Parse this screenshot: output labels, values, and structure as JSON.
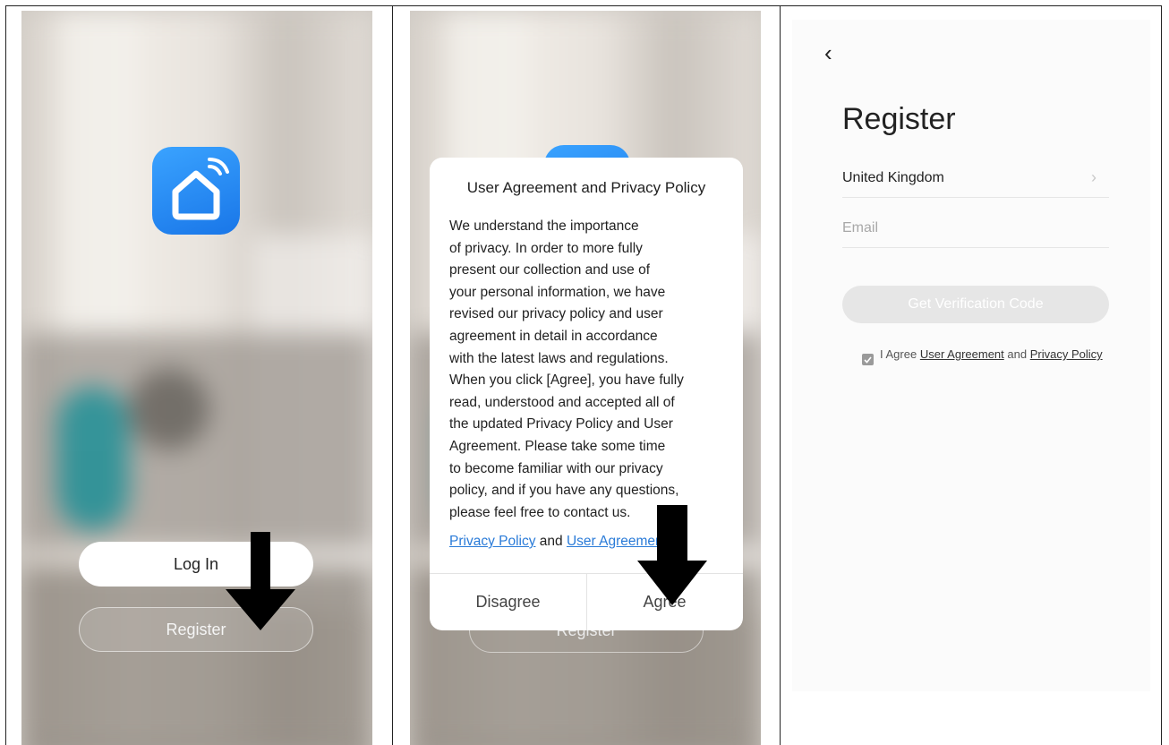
{
  "panel1": {
    "login_label": "Log In",
    "register_label": "Register"
  },
  "panel2": {
    "behind_register_label": "Register",
    "dialog": {
      "title": "User Agreement and Privacy Policy",
      "body": "We understand the importance\nof privacy. In order to more fully\npresent our collection and use of\nyour personal information, we have\nrevised our privacy policy and user\nagreement in detail in accordance\nwith the latest laws and regulations.\nWhen you click [Agree], you have fully\nread, understood and accepted all of\nthe updated Privacy Policy and User\nAgreement. Please take some time\nto become familiar with our privacy\npolicy, and if you have any questions,\nplease feel free to contact us.",
      "privacy_link": "Privacy Policy",
      "and_text": "and",
      "agreement_link": "User Agreement",
      "disagree_label": "Disagree",
      "agree_label": "Agree"
    }
  },
  "panel3": {
    "title": "Register",
    "country": "United Kingdom",
    "email_placeholder": "Email",
    "verify_label": "Get Verification Code",
    "agree_prefix": "I Agree",
    "agree_link1": "User Agreement",
    "agree_and": "and",
    "agree_link2": "Privacy Policy"
  },
  "colors": {
    "accent": "#2a7bd8",
    "app_icon": "#1976e8",
    "arrow": "#000000"
  }
}
